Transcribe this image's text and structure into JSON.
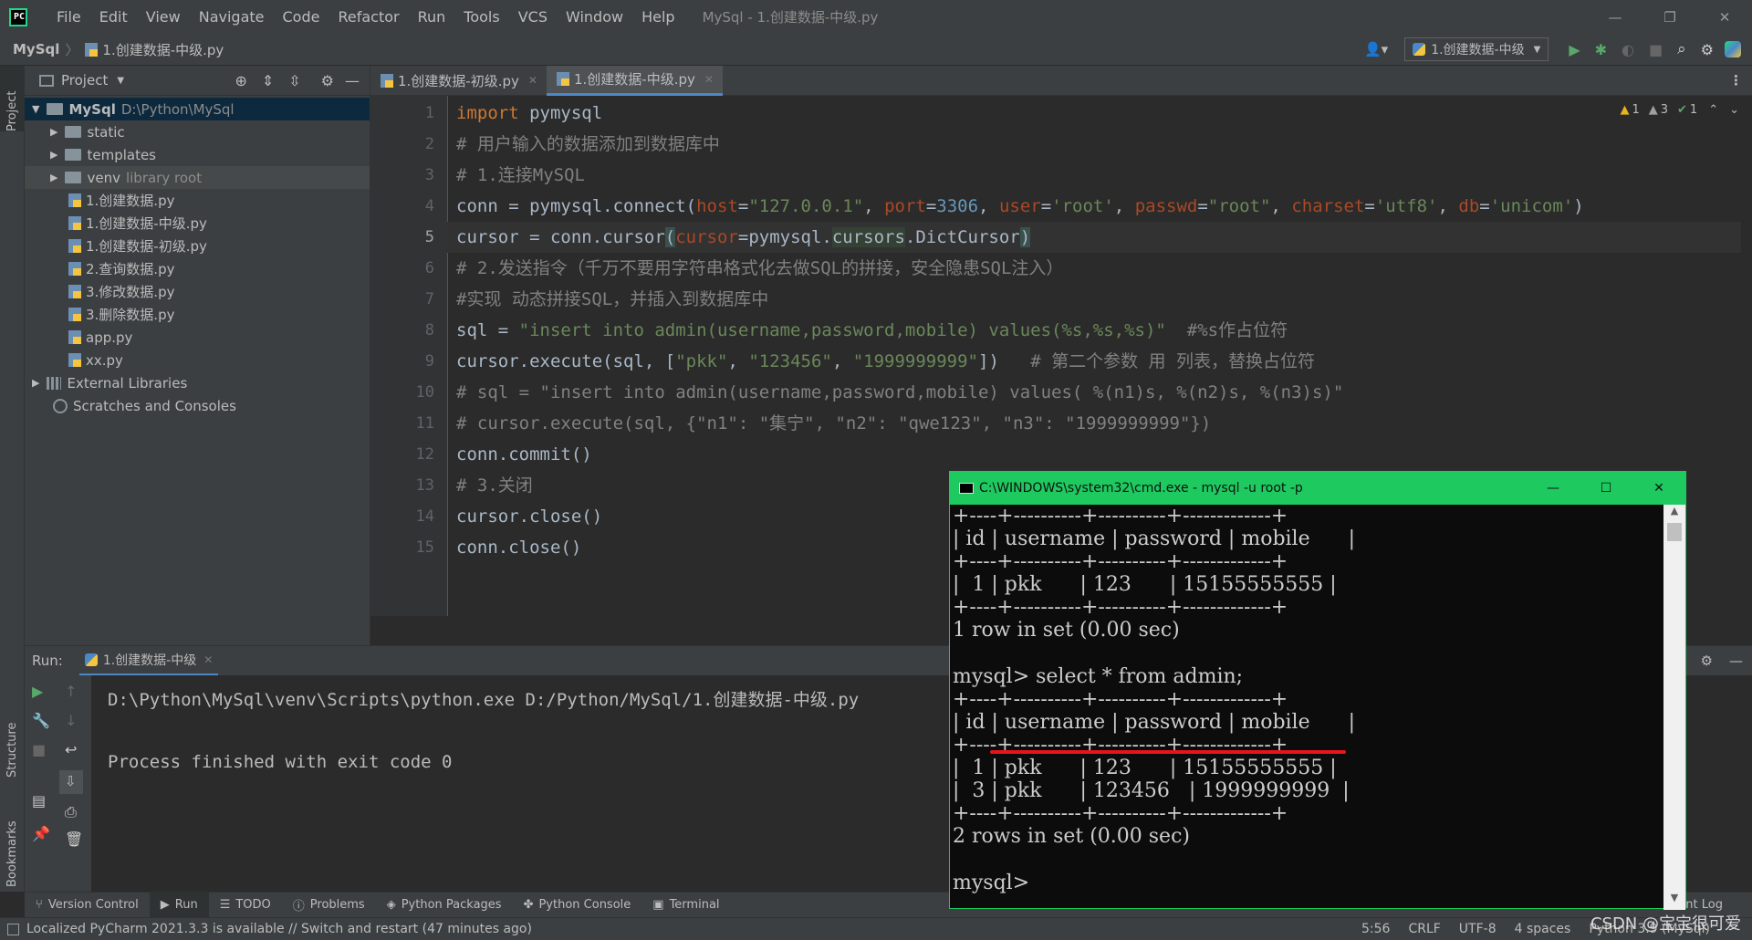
{
  "titlebar": {
    "menu": [
      "File",
      "Edit",
      "View",
      "Navigate",
      "Code",
      "Refactor",
      "Run",
      "Tools",
      "VCS",
      "Window",
      "Help"
    ],
    "title": "MySql - 1.创建数据-中级.py",
    "min": "—",
    "max": "❐",
    "close": "✕"
  },
  "navbar": {
    "project": "MySql",
    "file": "1.创建数据-中级.py",
    "run_config": "1.创建数据-中级"
  },
  "left_strip": {
    "project": "Project",
    "structure": "Structure",
    "bookmarks": "Bookmarks"
  },
  "project_panel": {
    "title": "Project",
    "root_name": "MySql",
    "root_path": "D:\\Python\\MySql",
    "items": [
      {
        "label": "static",
        "hint": "",
        "type": "folder"
      },
      {
        "label": "templates",
        "hint": "",
        "type": "folder"
      },
      {
        "label": "venv",
        "hint": "library root",
        "type": "folder"
      },
      {
        "label": "1.创建数据.py",
        "hint": "",
        "type": "file"
      },
      {
        "label": "1.创建数据-中级.py",
        "hint": "",
        "type": "file"
      },
      {
        "label": "1.创建数据-初级.py",
        "hint": "",
        "type": "file"
      },
      {
        "label": "2.查询数据.py",
        "hint": "",
        "type": "file"
      },
      {
        "label": "3.修改数据.py",
        "hint": "",
        "type": "file"
      },
      {
        "label": "3.删除数据.py",
        "hint": "",
        "type": "file"
      },
      {
        "label": "app.py",
        "hint": "",
        "type": "file"
      },
      {
        "label": "xx.py",
        "hint": "",
        "type": "file"
      }
    ],
    "external": "External Libraries",
    "scratches": "Scratches and Consoles"
  },
  "tabs": [
    {
      "label": "1.创建数据-初级.py",
      "active": false
    },
    {
      "label": "1.创建数据-中级.py",
      "active": true
    }
  ],
  "inspections": {
    "warn1": "1",
    "warn2": "3",
    "ok": "1"
  },
  "code": {
    "line_numbers": [
      "1",
      "2",
      "3",
      "4",
      "5",
      "6",
      "7",
      "8",
      "9",
      "10",
      "11",
      "12",
      "13",
      "14",
      "15"
    ],
    "current_line": "5"
  },
  "run_panel": {
    "label": "Run:",
    "tab": "1.创建数据-中级",
    "lines": [
      "D:\\Python\\MySql\\venv\\Scripts\\python.exe D:/Python/MySql/1.创建数据-中级.py",
      "",
      "Process finished with exit code 0"
    ]
  },
  "bottom_tools": [
    "Version Control",
    "Run",
    "TODO",
    "Problems",
    "Python Packages",
    "Python Console",
    "Terminal"
  ],
  "event_log": "Event Log",
  "status": {
    "message": "Localized PyCharm 2021.3.3 is available // Switch and restart (47 minutes ago)",
    "position": "5:56",
    "line_sep": "CRLF",
    "encoding": "UTF-8",
    "indent": "4 spaces",
    "interpreter": "Python 3.9 (MySql)"
  },
  "watermark": "CSDN @宝宝很可爱",
  "cmd": {
    "title": "C:\\WINDOWS\\system32\\cmd.exe - mysql  -u root -p",
    "lines": [
      "+----+----------+----------+-------------+",
      "| id | username | password | mobile      |",
      "+----+----------+----------+-------------+",
      "|  1 | pkk      | 123      | 15155555555 |",
      "+----+----------+----------+-------------+",
      "1 row in set (0.00 sec)",
      "",
      "mysql> select * from admin;",
      "+----+----------+----------+-------------+",
      "| id | username | password | mobile      |",
      "+----+----------+----------+-------------+",
      "|  1 | pkk      | 123      | 15155555555 |",
      "|  3 | pkk      | 123456   | 1999999999  |",
      "+----+----------+----------+-------------+",
      "2 rows in set (0.00 sec)",
      "",
      "mysql>"
    ],
    "highlight_color": "#e8141c"
  }
}
